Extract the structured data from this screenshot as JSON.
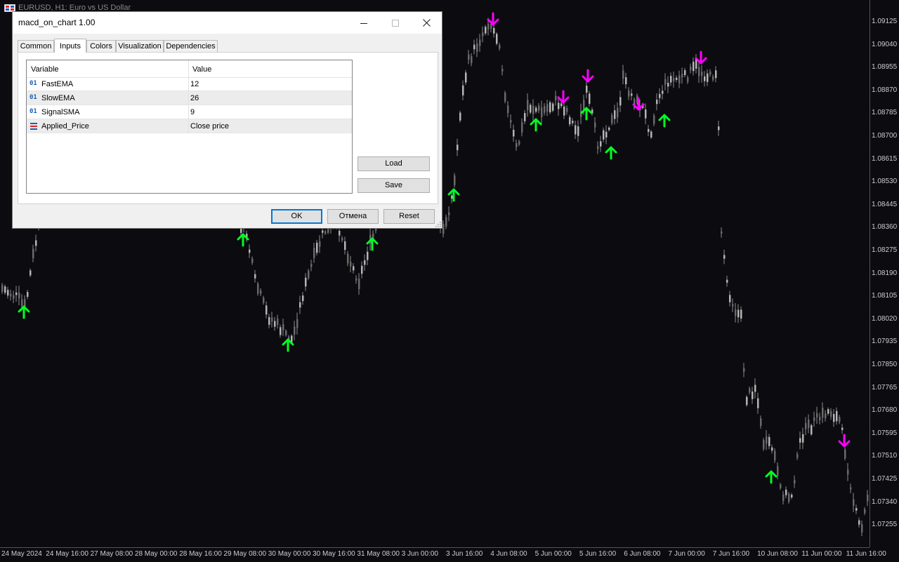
{
  "chart": {
    "title": "EURUSD, H1:  Euro vs US Dollar",
    "price_labels": [
      "1.09125",
      "1.09040",
      "1.08955",
      "1.08870",
      "1.08785",
      "1.08700",
      "1.08615",
      "1.08530",
      "1.08445",
      "1.08360",
      "1.08275",
      "1.08190",
      "1.08105",
      "1.08020",
      "1.07935",
      "1.07850",
      "1.07765",
      "1.07680",
      "1.07595",
      "1.07510",
      "1.07425",
      "1.07340",
      "1.07255"
    ],
    "time_labels": [
      "24 May 2024",
      "24 May 16:00",
      "27 May 08:00",
      "28 May 00:00",
      "28 May 16:00",
      "29 May 08:00",
      "30 May 00:00",
      "30 May 16:00",
      "31 May 08:00",
      "3 Jun 00:00",
      "3 Jun 16:00",
      "4 Jun 08:00",
      "5 Jun 00:00",
      "5 Jun 16:00",
      "6 Jun 08:00",
      "7 Jun 00:00",
      "7 Jun 16:00",
      "10 Jun 08:00",
      "11 Jun 00:00",
      "11 Jun 16:00"
    ],
    "colors": {
      "background": "#0b0b10",
      "candles": "#8c8c8c",
      "buy_arrow": "#00ff22",
      "sell_arrow": "#ff00ff"
    },
    "icon": "chart-menu-icon"
  },
  "dialog": {
    "title": "macd_on_chart 1.00",
    "tabs": [
      "Common",
      "Inputs",
      "Colors",
      "Visualization",
      "Dependencies"
    ],
    "active_tab": "Inputs",
    "table": {
      "headers": [
        "Variable",
        "Value"
      ],
      "rows": [
        {
          "icon": "int-param-icon",
          "icon_text": "01",
          "variable": "FastEMA",
          "value": "12"
        },
        {
          "icon": "int-param-icon",
          "icon_text": "01",
          "variable": "SlowEMA",
          "value": "26"
        },
        {
          "icon": "int-param-icon",
          "icon_text": "01",
          "variable": "SignalSMA",
          "value": "9"
        },
        {
          "icon": "enum-param-icon",
          "icon_text": "",
          "variable": "Applied_Price",
          "value": "Close price"
        }
      ]
    },
    "side_buttons": {
      "load": "Load",
      "save": "Save"
    },
    "footer_buttons": {
      "ok": "OK",
      "cancel": "Отмена",
      "reset": "Reset"
    }
  }
}
